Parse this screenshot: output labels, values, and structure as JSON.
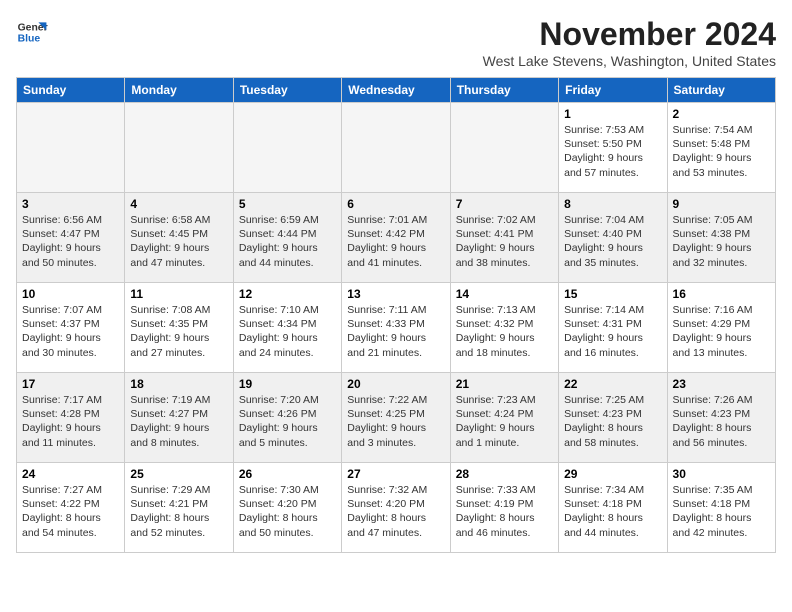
{
  "logo": {
    "line1": "General",
    "line2": "Blue"
  },
  "title": "November 2024",
  "subtitle": "West Lake Stevens, Washington, United States",
  "days_of_week": [
    "Sunday",
    "Monday",
    "Tuesday",
    "Wednesday",
    "Thursday",
    "Friday",
    "Saturday"
  ],
  "weeks": [
    [
      {
        "day": "",
        "info": ""
      },
      {
        "day": "",
        "info": ""
      },
      {
        "day": "",
        "info": ""
      },
      {
        "day": "",
        "info": ""
      },
      {
        "day": "",
        "info": ""
      },
      {
        "day": "1",
        "info": "Sunrise: 7:53 AM\nSunset: 5:50 PM\nDaylight: 9 hours and 57 minutes."
      },
      {
        "day": "2",
        "info": "Sunrise: 7:54 AM\nSunset: 5:48 PM\nDaylight: 9 hours and 53 minutes."
      }
    ],
    [
      {
        "day": "3",
        "info": "Sunrise: 6:56 AM\nSunset: 4:47 PM\nDaylight: 9 hours and 50 minutes."
      },
      {
        "day": "4",
        "info": "Sunrise: 6:58 AM\nSunset: 4:45 PM\nDaylight: 9 hours and 47 minutes."
      },
      {
        "day": "5",
        "info": "Sunrise: 6:59 AM\nSunset: 4:44 PM\nDaylight: 9 hours and 44 minutes."
      },
      {
        "day": "6",
        "info": "Sunrise: 7:01 AM\nSunset: 4:42 PM\nDaylight: 9 hours and 41 minutes."
      },
      {
        "day": "7",
        "info": "Sunrise: 7:02 AM\nSunset: 4:41 PM\nDaylight: 9 hours and 38 minutes."
      },
      {
        "day": "8",
        "info": "Sunrise: 7:04 AM\nSunset: 4:40 PM\nDaylight: 9 hours and 35 minutes."
      },
      {
        "day": "9",
        "info": "Sunrise: 7:05 AM\nSunset: 4:38 PM\nDaylight: 9 hours and 32 minutes."
      }
    ],
    [
      {
        "day": "10",
        "info": "Sunrise: 7:07 AM\nSunset: 4:37 PM\nDaylight: 9 hours and 30 minutes."
      },
      {
        "day": "11",
        "info": "Sunrise: 7:08 AM\nSunset: 4:35 PM\nDaylight: 9 hours and 27 minutes."
      },
      {
        "day": "12",
        "info": "Sunrise: 7:10 AM\nSunset: 4:34 PM\nDaylight: 9 hours and 24 minutes."
      },
      {
        "day": "13",
        "info": "Sunrise: 7:11 AM\nSunset: 4:33 PM\nDaylight: 9 hours and 21 minutes."
      },
      {
        "day": "14",
        "info": "Sunrise: 7:13 AM\nSunset: 4:32 PM\nDaylight: 9 hours and 18 minutes."
      },
      {
        "day": "15",
        "info": "Sunrise: 7:14 AM\nSunset: 4:31 PM\nDaylight: 9 hours and 16 minutes."
      },
      {
        "day": "16",
        "info": "Sunrise: 7:16 AM\nSunset: 4:29 PM\nDaylight: 9 hours and 13 minutes."
      }
    ],
    [
      {
        "day": "17",
        "info": "Sunrise: 7:17 AM\nSunset: 4:28 PM\nDaylight: 9 hours and 11 minutes."
      },
      {
        "day": "18",
        "info": "Sunrise: 7:19 AM\nSunset: 4:27 PM\nDaylight: 9 hours and 8 minutes."
      },
      {
        "day": "19",
        "info": "Sunrise: 7:20 AM\nSunset: 4:26 PM\nDaylight: 9 hours and 5 minutes."
      },
      {
        "day": "20",
        "info": "Sunrise: 7:22 AM\nSunset: 4:25 PM\nDaylight: 9 hours and 3 minutes."
      },
      {
        "day": "21",
        "info": "Sunrise: 7:23 AM\nSunset: 4:24 PM\nDaylight: 9 hours and 1 minute."
      },
      {
        "day": "22",
        "info": "Sunrise: 7:25 AM\nSunset: 4:23 PM\nDaylight: 8 hours and 58 minutes."
      },
      {
        "day": "23",
        "info": "Sunrise: 7:26 AM\nSunset: 4:23 PM\nDaylight: 8 hours and 56 minutes."
      }
    ],
    [
      {
        "day": "24",
        "info": "Sunrise: 7:27 AM\nSunset: 4:22 PM\nDaylight: 8 hours and 54 minutes."
      },
      {
        "day": "25",
        "info": "Sunrise: 7:29 AM\nSunset: 4:21 PM\nDaylight: 8 hours and 52 minutes."
      },
      {
        "day": "26",
        "info": "Sunrise: 7:30 AM\nSunset: 4:20 PM\nDaylight: 8 hours and 50 minutes."
      },
      {
        "day": "27",
        "info": "Sunrise: 7:32 AM\nSunset: 4:20 PM\nDaylight: 8 hours and 47 minutes."
      },
      {
        "day": "28",
        "info": "Sunrise: 7:33 AM\nSunset: 4:19 PM\nDaylight: 8 hours and 46 minutes."
      },
      {
        "day": "29",
        "info": "Sunrise: 7:34 AM\nSunset: 4:18 PM\nDaylight: 8 hours and 44 minutes."
      },
      {
        "day": "30",
        "info": "Sunrise: 7:35 AM\nSunset: 4:18 PM\nDaylight: 8 hours and 42 minutes."
      }
    ]
  ]
}
